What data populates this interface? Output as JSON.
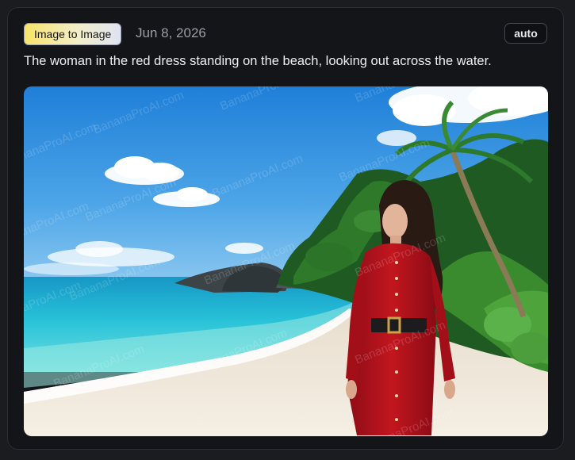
{
  "card": {
    "mode_label": "Image to Image",
    "date": "Jun 8, 2026",
    "ratio_label": "auto",
    "prompt": "The woman in the red dress standing on the beach, looking out across the water."
  },
  "image": {
    "watermark_text": "BananaProAI.com",
    "subject": "woman in red dress on tropical beach"
  },
  "colors": {
    "background": "#1b1c20",
    "card": "#141519",
    "badge_gradient_start": "#f8e36a",
    "badge_gradient_end": "#dfe3f3",
    "date_text": "#9c9ea6",
    "dress": "#b3121c"
  }
}
